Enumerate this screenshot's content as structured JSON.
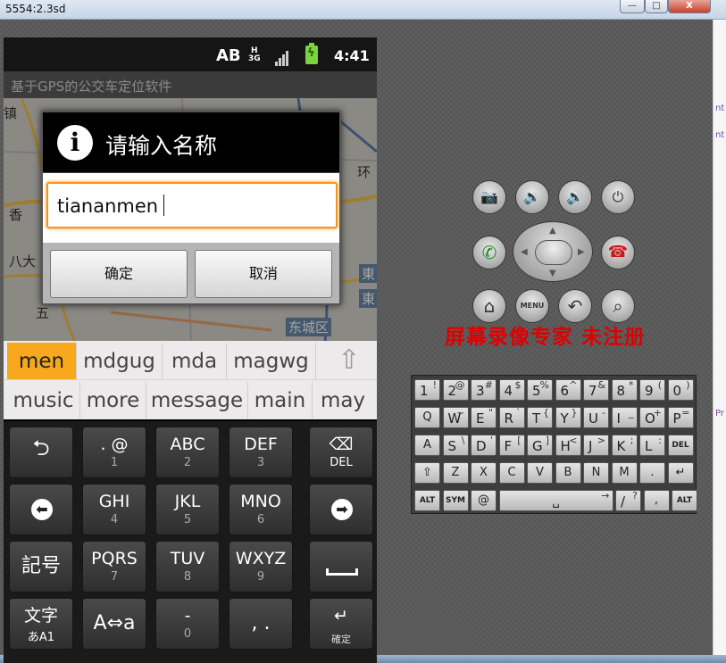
{
  "window": {
    "title": "5554:2.3sd",
    "min_label": "—",
    "max_label": "□",
    "close_label": "X"
  },
  "right_strip": {
    "items": [
      "nt",
      "nt",
      "Pr"
    ]
  },
  "status_bar": {
    "ab": "AB",
    "net_top": "H",
    "net_bottom": "3G",
    "battery_icon": "battery-charging-icon",
    "battery_glyph": "ϟ",
    "time": "4:41",
    "colors": {
      "battery": "#7bd33f"
    }
  },
  "app": {
    "title": "基于GPS的公交车定位软件"
  },
  "map": {
    "labels": [
      "镇",
      "香",
      "八大",
      "五",
      "环",
      "東",
      "東",
      "东城区"
    ]
  },
  "dialog": {
    "title": "请输入名称",
    "icon_glyph": "i",
    "input_value": "tiananmen",
    "ok_label": "确定",
    "cancel_label": "取消",
    "accent": "#f7941d"
  },
  "candidates": {
    "row1": [
      "men",
      "mdgug",
      "mda",
      "magwg"
    ],
    "row2": [
      "music",
      "more",
      "message",
      "main",
      "may"
    ],
    "shift_glyph": "⇧",
    "selected_color": "#f7a81c"
  },
  "phone_keys": {
    "back": "⮌",
    "k1_main": ". @",
    "k1_sub": "1",
    "k2_main": "ABC",
    "k2_sub": "2",
    "k3_main": "DEF",
    "k3_sub": "3",
    "del_icon": "⌫",
    "del_label": "DEL",
    "left_arrow": "⬅",
    "k4_main": "GHI",
    "k4_sub": "4",
    "k5_main": "JKL",
    "k5_sub": "5",
    "k6_main": "MNO",
    "k6_sub": "6",
    "right_arrow": "➡",
    "symbols": "記号",
    "k7_main": "PQRS",
    "k7_sub": "7",
    "k8_main": "TUV",
    "k8_sub": "8",
    "k9_main": "WXYZ",
    "k9_sub": "9",
    "mode_main": "文字",
    "mode_sub": "あA1",
    "toggle_case": "A⇔a",
    "k0_main": "-",
    "k0_sub": "0",
    "punct": ", .",
    "enter_icon": "↵",
    "enter_label": "確定"
  },
  "emulator": {
    "camera": "📷",
    "vol_down": "🔉",
    "vol_up": "🔊",
    "power": "⏻",
    "call": "✆",
    "end_call": "☎",
    "home": "⌂",
    "menu": "MENU",
    "back": "↶",
    "search": "⌕",
    "watermark": "屏幕录像专家  未注册"
  },
  "qwerty": {
    "row1": [
      [
        "1",
        "!"
      ],
      [
        "2",
        "@"
      ],
      [
        "3",
        "#"
      ],
      [
        "4",
        "$"
      ],
      [
        "5",
        "%"
      ],
      [
        "6",
        "^"
      ],
      [
        "7",
        "&"
      ],
      [
        "8",
        "*"
      ],
      [
        "9",
        "("
      ],
      [
        "0",
        ")"
      ]
    ],
    "row2": [
      [
        "Q",
        ""
      ],
      [
        "W",
        "~"
      ],
      [
        "E",
        "\""
      ],
      [
        "R",
        "`"
      ],
      [
        "T",
        "{"
      ],
      [
        "Y",
        "}"
      ],
      [
        "U",
        "-"
      ],
      [
        "I",
        "_"
      ],
      [
        "O",
        "+"
      ],
      [
        "P",
        "="
      ]
    ],
    "row3": [
      [
        "A",
        ""
      ],
      [
        "S",
        "\\"
      ],
      [
        "D",
        "'"
      ],
      [
        "F",
        "["
      ],
      [
        "G",
        "]"
      ],
      [
        "H",
        "<"
      ],
      [
        "J",
        ">"
      ],
      [
        "K",
        ";"
      ],
      [
        "L",
        ":"
      ],
      [
        "DEL",
        ""
      ]
    ],
    "row4": [
      [
        "⇧",
        ""
      ],
      [
        "Z",
        ""
      ],
      [
        "X",
        ""
      ],
      [
        "C",
        ""
      ],
      [
        "V",
        ""
      ],
      [
        "B",
        ""
      ],
      [
        "N",
        ""
      ],
      [
        "M",
        ""
      ],
      [
        ".",
        ""
      ],
      [
        "↵",
        ""
      ]
    ],
    "row5": [
      [
        "ALT",
        ""
      ],
      [
        "SYM",
        ""
      ],
      [
        "@",
        ""
      ],
      [
        "␣",
        "→"
      ],
      [
        "/",
        "?"
      ],
      [
        ",",
        ""
      ],
      [
        "ALT",
        ""
      ]
    ]
  }
}
